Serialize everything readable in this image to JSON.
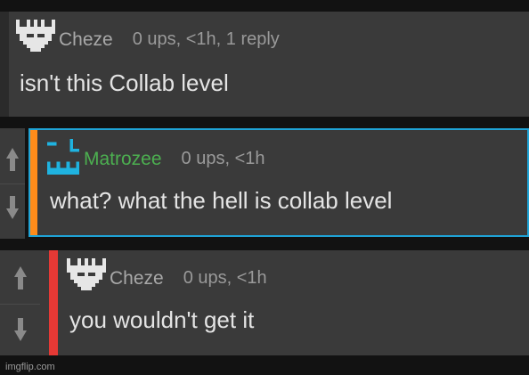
{
  "colors": {
    "page_bg": "#121212",
    "comment_bg": "#3a3a3a",
    "highlight_border": "#1fa3d6",
    "accent_orange": "#ff8c1a",
    "accent_red": "#e53935",
    "username_green": "#4caf50",
    "username_gray": "#a8a8a8"
  },
  "comments": [
    {
      "username": "Cheze",
      "meta": "0 ups, <1h, 1 reply",
      "text": "isn't this Collab level",
      "avatar_icon": "pixel-crest-icon"
    },
    {
      "username": "Matrozee",
      "meta": "0 ups, <1h",
      "text": "what? what the hell is collab level",
      "avatar_icon": "pixel-castle-icon"
    },
    {
      "username": "Cheze",
      "meta": "0 ups, <1h",
      "text": "you wouldn't get it",
      "avatar_icon": "pixel-crest-icon"
    }
  ],
  "watermark": "imgflip.com"
}
